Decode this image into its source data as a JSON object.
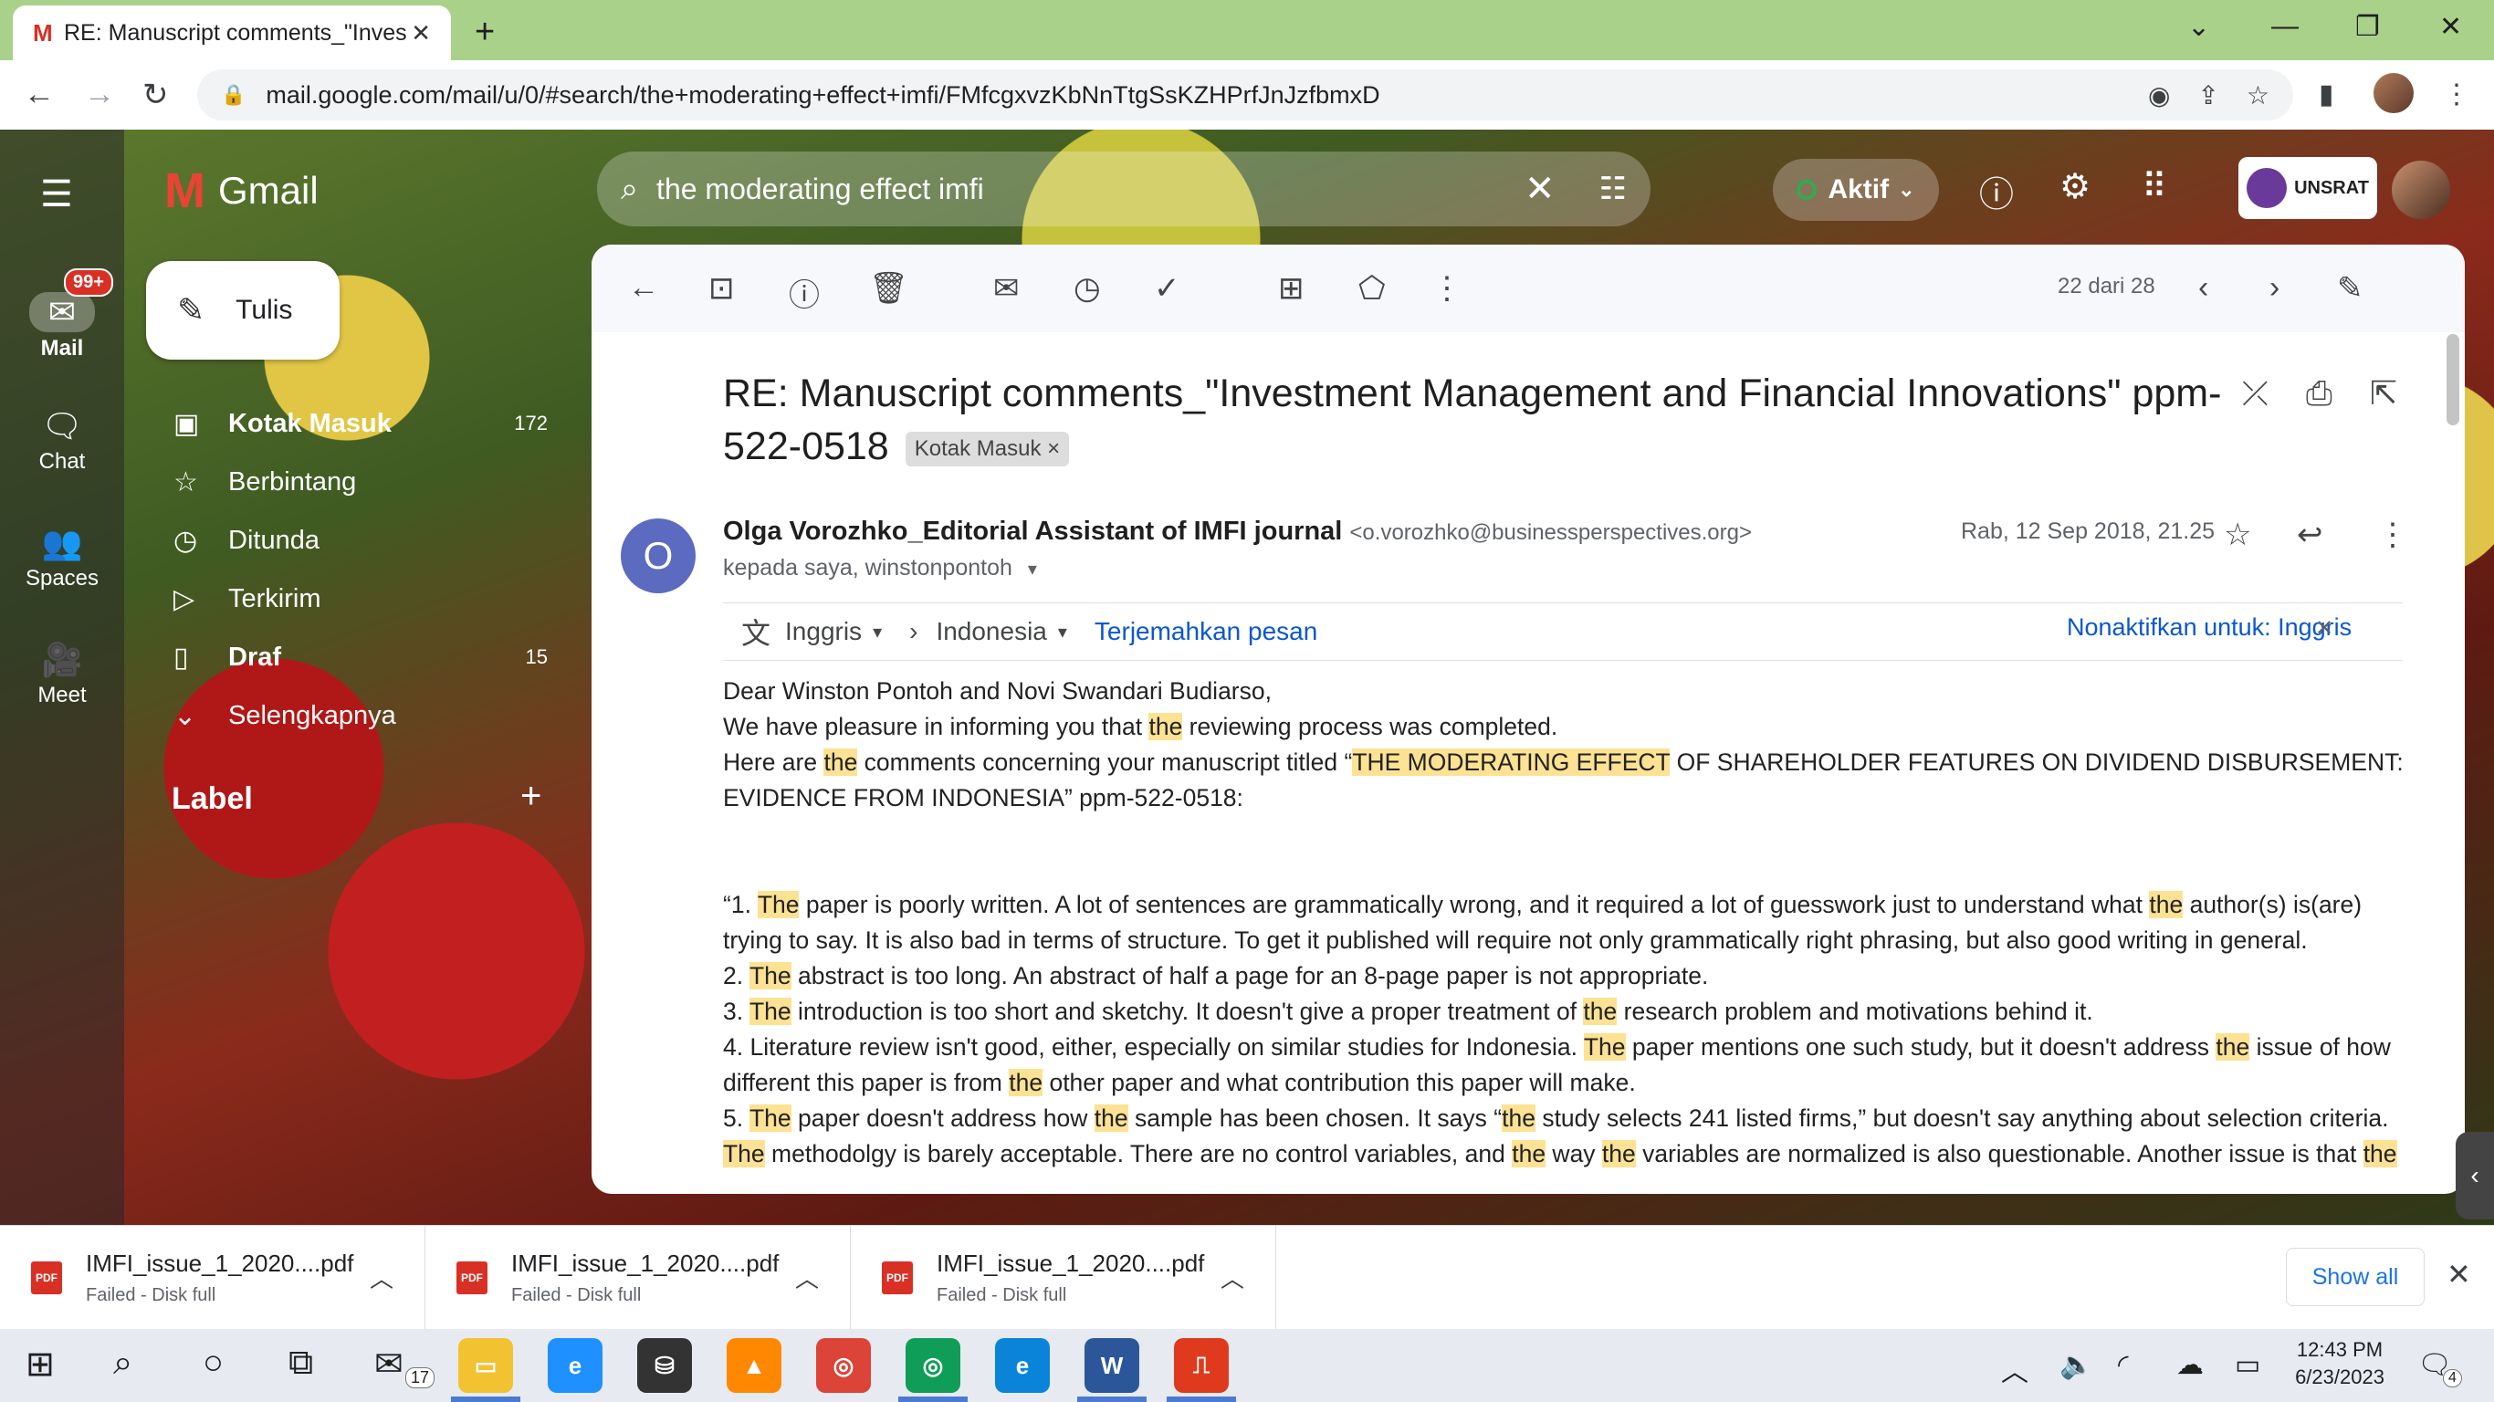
{
  "browser": {
    "tab_title": "RE: Manuscript comments_\"Inves",
    "tab_favicon": "M",
    "url": "mail.google.com/mail/u/0/#search/the+moderating+effect+imfi/FMfcgxvzKbNnTtgSsKZHPrfJnJzfbmxD"
  },
  "gmail": {
    "logo_text": "Gmail",
    "search_value": "the moderating effect imfi",
    "status": "Aktif",
    "org_label": "UNSRAT",
    "rail": [
      {
        "label": "Mail",
        "badge": "99+"
      },
      {
        "label": "Chat"
      },
      {
        "label": "Spaces"
      },
      {
        "label": "Meet"
      }
    ],
    "compose_label": "Tulis",
    "nav": [
      {
        "label": "Kotak Masuk",
        "count": "172"
      },
      {
        "label": "Berbintang",
        "count": ""
      },
      {
        "label": "Ditunda",
        "count": ""
      },
      {
        "label": "Terkirim",
        "count": ""
      },
      {
        "label": "Draf",
        "count": "15"
      },
      {
        "label": "Selengkapnya",
        "count": ""
      }
    ],
    "label_header": "Label"
  },
  "message": {
    "pager": "22 dari 28",
    "subject": "RE: Manuscript comments_\"Investment Management and Financial Innovations\" ppm-522-0518",
    "inbox_chip": "Kotak Masuk",
    "chip_close": "×",
    "avatar_letter": "O",
    "sender_name": "Olga Vorozhko_Editorial Assistant of IMFI journal",
    "sender_email": "<o.vorozhko@businessperspectives.org>",
    "to_line": "kepada saya, winstonpontoh",
    "date": "Rab, 12 Sep 2018, 21.25",
    "translate": {
      "from": "Inggris",
      "to": "Indonesia",
      "action": "Terjemahkan pesan",
      "disable": "Nonaktifkan untuk: Inggris"
    },
    "body": {
      "greeting": "Dear Winston Pontoh and Novi Swandari Budiarso,",
      "l1_a": "We have pleasure in informing you that ",
      "l1_b": " reviewing process was completed.",
      "l2_a": "Here are ",
      "l2_b": " comments concerning your manuscript titled “",
      "l2_c": "THE MODERATING EFFECT",
      "l2_d": " OF SHAREHOLDER FEATURES ON DIVIDEND DISBURSEMENT: EVIDENCE FROM INDONESIA” ppm-522-0518:",
      "p1_a": "“1. ",
      "p1_b": " paper is poorly written. A lot of sentences are grammatically wrong, and it required a lot of guesswork just to understand what ",
      "p1_c": " author(s) is(are) trying to say. It is also bad in terms of structure. To get it published will require not only grammatically right phrasing, but also good writing in general.",
      "p2_a": "2. ",
      "p2_b": " abstract is too long. An abstract of half a page for an 8-page paper is not appropriate.",
      "p3_a": "3. ",
      "p3_b": " introduction is too short and sketchy. It doesn't give a proper treatment of ",
      "p3_c": " research problem and motivations behind it.",
      "p4_a": "4. Literature review isn't good, either, especially on similar studies for Indonesia. ",
      "p4_b": " paper mentions one such study, but it doesn't address ",
      "p4_c": " issue of how different this paper is from ",
      "p4_d": " other paper and what contribution this paper will make.",
      "p5_a": "5. ",
      "p5_b": " paper doesn't address how ",
      "p5_c": " sample has been chosen. It says “",
      "p5_d": " study selects 241 listed firms,” but doesn't say anything about selection criteria. ",
      "p5_e": " methodolgy is barely acceptable. There are no control variables, and ",
      "p5_f": " way ",
      "p5_g": " variables are normalized is also questionable. Another issue is that ",
      "w_the": "the",
      "w_The": "The"
    }
  },
  "downloads": {
    "items": [
      {
        "name": "IMFI_issue_1_2020....pdf",
        "status": "Failed - Disk full"
      },
      {
        "name": "IMFI_issue_1_2020....pdf",
        "status": "Failed - Disk full"
      },
      {
        "name": "IMFI_issue_1_2020....pdf",
        "status": "Failed - Disk full"
      }
    ],
    "show_all": "Show all",
    "file_badge": "PDF"
  },
  "taskbar": {
    "mail_badge": "17",
    "notif_count": "4",
    "time": "12:43 PM",
    "date": "6/23/2023"
  },
  "colors": {
    "highlight": "#fde293",
    "link": "#0b57d0",
    "accent": "#1a73e8",
    "alert": "#d93025"
  }
}
